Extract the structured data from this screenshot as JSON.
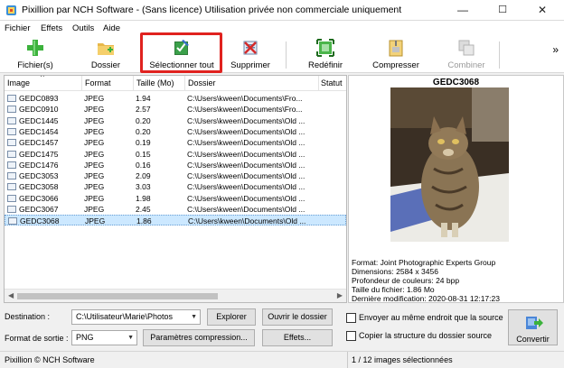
{
  "window": {
    "title": "Pixillion par NCH Software - (Sans licence) Utilisation privée non commerciale uniquement",
    "minimize": "—",
    "maximize": "☐",
    "close": "✕"
  },
  "menu": [
    "Fichier",
    "Effets",
    "Outils",
    "Aide"
  ],
  "toolbar": {
    "buttons": [
      {
        "label": "Fichier(s)",
        "icon": "add-file-icon"
      },
      {
        "label": "Dossier",
        "icon": "add-folder-icon"
      },
      {
        "label": "Sélectionner tout",
        "icon": "select-all-icon"
      },
      {
        "label": "Supprimer",
        "icon": "remove-icon"
      },
      {
        "label": "Redéfinir",
        "icon": "resize-icon"
      },
      {
        "label": "Compresser",
        "icon": "compress-icon"
      },
      {
        "label": "Combiner",
        "icon": "combine-icon",
        "disabled": true
      }
    ],
    "more": "»"
  },
  "annotation": {
    "color": "#e0221f"
  },
  "list": {
    "columns": [
      "Image",
      "Format",
      "Taille (Mo)",
      "Dossier",
      "Statut"
    ],
    "rows": [
      {
        "name": "GEDC0893",
        "format": "JPEG",
        "size": "1.94",
        "folder": "C:\\Users\\kween\\Documents\\Fro..."
      },
      {
        "name": "GEDC0910",
        "format": "JPEG",
        "size": "2.57",
        "folder": "C:\\Users\\kween\\Documents\\Fro..."
      },
      {
        "name": "GEDC1445",
        "format": "JPEG",
        "size": "0.20",
        "folder": "C:\\Users\\kween\\Documents\\Old ..."
      },
      {
        "name": "GEDC1454",
        "format": "JPEG",
        "size": "0.20",
        "folder": "C:\\Users\\kween\\Documents\\Old ..."
      },
      {
        "name": "GEDC1457",
        "format": "JPEG",
        "size": "0.19",
        "folder": "C:\\Users\\kween\\Documents\\Old ..."
      },
      {
        "name": "GEDC1475",
        "format": "JPEG",
        "size": "0.15",
        "folder": "C:\\Users\\kween\\Documents\\Old ..."
      },
      {
        "name": "GEDC1476",
        "format": "JPEG",
        "size": "0.16",
        "folder": "C:\\Users\\kween\\Documents\\Old ..."
      },
      {
        "name": "GEDC3053",
        "format": "JPEG",
        "size": "2.09",
        "folder": "C:\\Users\\kween\\Documents\\Old ..."
      },
      {
        "name": "GEDC3058",
        "format": "JPEG",
        "size": "3.03",
        "folder": "C:\\Users\\kween\\Documents\\Old ..."
      },
      {
        "name": "GEDC3066",
        "format": "JPEG",
        "size": "1.98",
        "folder": "C:\\Users\\kween\\Documents\\Old ..."
      },
      {
        "name": "GEDC3067",
        "format": "JPEG",
        "size": "2.45",
        "folder": "C:\\Users\\kween\\Documents\\Old ..."
      },
      {
        "name": "GEDC3068",
        "format": "JPEG",
        "size": "1.86",
        "folder": "C:\\Users\\kween\\Documents\\Old ...",
        "selected": true
      }
    ]
  },
  "preview": {
    "title": "GEDC3068",
    "meta": [
      "Format: Joint Photographic Experts Group",
      "Dimensions: 2584 x 3456",
      "Profondeur de couleurs: 24 bpp",
      "Taille du fichier: 1.86 Mo",
      "Dernière modification: 2020-08-31 12:17:23"
    ]
  },
  "output": {
    "destination_label": "Destination :",
    "destination_value": "C:\\Utilisateur\\Marie\\Photos",
    "browse": "Explorer",
    "open_folder": "Ouvrir le dossier",
    "format_label": "Format de sortie :",
    "format_value": "PNG",
    "compression_settings": "Paramètres compression...",
    "effects": "Effets...",
    "same_location": "Envoyer au même endroit que la source",
    "copy_structure": "Copier la structure du dossier source",
    "convert": "Convertir"
  },
  "status": {
    "left": "Pixillion © NCH Software",
    "right": "1 / 12 images sélectionnées"
  }
}
